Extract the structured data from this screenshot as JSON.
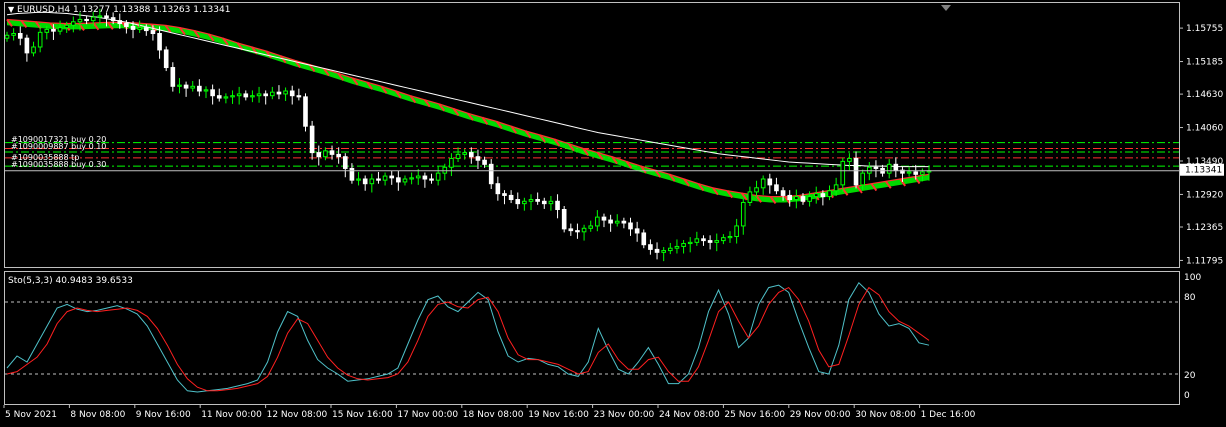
{
  "header": {
    "symbol_line": "EURUSD,H4  1.13277 1.13388 1.13263 1.13341"
  },
  "stochastic": {
    "label": "Sto(5,3,3) 40.9483 39.6533",
    "levels": [
      "100",
      "80",
      "20",
      "0"
    ]
  },
  "orders": {
    "labels": [
      "#1090017321 buy 0.20",
      "#1090009887 buy 0.10",
      "#1090035888 buy 0.30"
    ],
    "label_sub": "#1090035888 tp"
  },
  "colors": {
    "bull": "#00ff00",
    "bear": "#ffffff",
    "ma_long": "#ffffff",
    "band_red": "#ff3030",
    "band_green": "#00ff00",
    "sto_main": "#4fc1c9",
    "sto_signal": "#ff2020",
    "grid": "#808080",
    "bg": "#000000"
  },
  "chart_data": {
    "type": "line",
    "symbol": "EURUSD",
    "timeframe": "H4",
    "price_axis": [
      "1.15755",
      "1.15185",
      "1.14630",
      "1.14060",
      "1.13490",
      "1.12920",
      "1.12365",
      "1.11795"
    ],
    "current_price": "1.13341",
    "ylim": [
      1.117,
      1.162
    ],
    "time_axis": [
      "5 Nov 2021",
      "8 Nov 08:00",
      "9 Nov 16:00",
      "11 Nov 00:00",
      "12 Nov 08:00",
      "15 Nov 16:00",
      "17 Nov 00:00",
      "18 Nov 08:00",
      "19 Nov 16:00",
      "23 Nov 00:00",
      "24 Nov 08:00",
      "25 Nov 16:00",
      "29 Nov 00:00",
      "30 Nov 08:00",
      "1 Dec 16:00"
    ],
    "order_levels": [
      1.1382,
      1.1372,
      1.1366,
      1.1356,
      1.1342
    ],
    "close": [
      1.1565,
      1.1568,
      1.156,
      1.1535,
      1.1545,
      1.157,
      1.1575,
      1.1572,
      1.1578,
      1.1582,
      1.1588,
      1.1592,
      1.159,
      1.1596,
      1.1598,
      1.1595,
      1.159,
      1.1585,
      1.158,
      1.1575,
      1.1578,
      1.1573,
      1.1568,
      1.154,
      1.151,
      1.1478,
      1.148,
      1.1475,
      1.1478,
      1.147,
      1.1472,
      1.1462,
      1.1458,
      1.146,
      1.1462,
      1.1465,
      1.146,
      1.1462,
      1.1465,
      1.1462,
      1.1468,
      1.1465,
      1.147,
      1.1462,
      1.146,
      1.141,
      1.1365,
      1.1358,
      1.1368,
      1.1362,
      1.1358,
      1.1338,
      1.1318,
      1.132,
      1.1312,
      1.132,
      1.1318,
      1.1325,
      1.1322,
      1.1315,
      1.132,
      1.1322,
      1.1325,
      1.132,
      1.1318,
      1.133,
      1.134,
      1.1355,
      1.1362,
      1.1365,
      1.1358,
      1.1352,
      1.1345,
      1.1312,
      1.1295,
      1.1292,
      1.1285,
      1.1278,
      1.1282,
      1.1285,
      1.1282,
      1.1278,
      1.1282,
      1.1268,
      1.1235,
      1.1232,
      1.123,
      1.1236,
      1.124,
      1.1255,
      1.125,
      1.1245,
      1.1248,
      1.1245,
      1.1235,
      1.1228,
      1.1208,
      1.12,
      1.1195,
      1.1198,
      1.1202,
      1.1205,
      1.121,
      1.1212,
      1.1218,
      1.1215,
      1.1212,
      1.1215,
      1.122,
      1.1222,
      1.124,
      1.128,
      1.1298,
      1.1305,
      1.132,
      1.131,
      1.13,
      1.1292,
      1.1285,
      1.129,
      1.1282,
      1.129,
      1.1295,
      1.129,
      1.13,
      1.131,
      1.135,
      1.1355,
      1.131,
      1.133,
      1.134,
      1.1338,
      1.133,
      1.1345,
      1.1335,
      1.133,
      1.1332,
      1.1328,
      1.1332,
      1.1334
    ],
    "ma_long": [
      1.16,
      1.1602,
      1.1603,
      1.1604,
      1.1604,
      1.1603,
      1.1602,
      1.16,
      1.1598,
      1.1596,
      1.1593,
      1.159,
      1.1587,
      1.1583,
      1.1579,
      1.1575,
      1.1571,
      1.1567,
      1.1563,
      1.1559,
      1.1555,
      1.1551,
      1.1547,
      1.1543,
      1.1539,
      1.1535,
      1.1531,
      1.1527,
      1.1523,
      1.1519,
      1.1515,
      1.1511,
      1.1507,
      1.1503,
      1.1499,
      1.1495,
      1.1491,
      1.1487,
      1.1483,
      1.1479,
      1.1475,
      1.1471,
      1.1467,
      1.1463,
      1.1459,
      1.1455,
      1.1451,
      1.1447,
      1.1443,
      1.1439,
      1.1435,
      1.1431,
      1.1427,
      1.1423,
      1.1419,
      1.1415,
      1.1411,
      1.1407,
      1.1403,
      1.1399,
      1.1396,
      1.1393,
      1.139,
      1.1387,
      1.1384,
      1.1381,
      1.1378,
      1.1375,
      1.1372,
      1.1369,
      1.1366,
      1.1363,
      1.1361,
      1.1359,
      1.1357,
      1.1355,
      1.1353,
      1.1351,
      1.1349,
      1.1348,
      1.1347,
      1.1346,
      1.1345,
      1.1344,
      1.1343,
      1.1343,
      1.1342,
      1.1342,
      1.1342,
      1.1341,
      1.1341,
      1.1341,
      1.1341
    ],
    "band_upper": [
      1.1592,
      1.159,
      1.1588,
      1.1586,
      1.1585,
      1.1585,
      1.1586,
      1.1587,
      1.1587,
      1.1586,
      1.1584,
      1.1582,
      1.1578,
      1.1573,
      1.1567,
      1.156,
      1.1552,
      1.1545,
      1.1538,
      1.153,
      1.1522,
      1.1515,
      1.1508,
      1.15,
      1.1492,
      1.1485,
      1.1478,
      1.147,
      1.1462,
      1.1455,
      1.1448,
      1.144,
      1.1432,
      1.1425,
      1.1418,
      1.141,
      1.1402,
      1.1395,
      1.1388,
      1.138,
      1.1372,
      1.1365,
      1.1358,
      1.135,
      1.1342,
      1.1335,
      1.1328,
      1.132,
      1.1312,
      1.1305,
      1.13,
      1.1296,
      1.1292,
      1.129,
      1.129,
      1.1292,
      1.1296,
      1.13,
      1.1304,
      1.1308,
      1.1312,
      1.1316,
      1.132,
      1.1324,
      1.1328
    ],
    "band_lower": [
      1.1582,
      1.158,
      1.1578,
      1.1576,
      1.1575,
      1.1575,
      1.1576,
      1.1577,
      1.1577,
      1.1576,
      1.1574,
      1.1572,
      1.1568,
      1.1563,
      1.1557,
      1.155,
      1.1542,
      1.1535,
      1.1528,
      1.152,
      1.1512,
      1.1505,
      1.1498,
      1.149,
      1.1482,
      1.1475,
      1.1468,
      1.146,
      1.1452,
      1.1445,
      1.1438,
      1.143,
      1.1422,
      1.1415,
      1.1408,
      1.14,
      1.1392,
      1.1385,
      1.1378,
      1.137,
      1.1362,
      1.1355,
      1.1348,
      1.134,
      1.1332,
      1.1325,
      1.1318,
      1.131,
      1.1302,
      1.1295,
      1.129,
      1.1286,
      1.1282,
      1.128,
      1.128,
      1.1282,
      1.1286,
      1.129,
      1.1294,
      1.1298,
      1.1302,
      1.1306,
      1.131,
      1.1314,
      1.1318
    ],
    "sto_main": [
      25,
      35,
      30,
      45,
      60,
      75,
      78,
      74,
      72,
      73,
      75,
      77,
      74,
      70,
      60,
      45,
      30,
      15,
      6,
      5,
      6,
      7,
      8,
      10,
      12,
      15,
      30,
      55,
      72,
      68,
      48,
      32,
      25,
      20,
      14,
      15,
      16,
      18,
      20,
      25,
      45,
      65,
      82,
      85,
      76,
      72,
      80,
      88,
      82,
      55,
      35,
      30,
      33,
      32,
      28,
      26,
      20,
      18,
      30,
      58,
      40,
      24,
      20,
      30,
      42,
      28,
      12,
      12,
      20,
      42,
      72,
      90,
      70,
      42,
      50,
      78,
      92,
      94,
      88,
      64,
      42,
      22,
      20,
      44,
      82,
      96,
      88,
      70,
      60,
      62,
      58,
      46,
      44
    ],
    "sto_signal": [
      20,
      22,
      28,
      34,
      45,
      62,
      72,
      75,
      73,
      72,
      73,
      74,
      75,
      73,
      68,
      58,
      44,
      28,
      16,
      9,
      6,
      6,
      7,
      8,
      10,
      12,
      18,
      34,
      54,
      66,
      62,
      48,
      34,
      25,
      19,
      16,
      15,
      16,
      17,
      20,
      30,
      48,
      68,
      78,
      80,
      76,
      75,
      82,
      84,
      72,
      50,
      36,
      32,
      32,
      30,
      28,
      24,
      20,
      22,
      38,
      45,
      32,
      24,
      24,
      32,
      34,
      22,
      14,
      14,
      26,
      48,
      72,
      80,
      64,
      50,
      60,
      78,
      88,
      92,
      82,
      64,
      40,
      26,
      28,
      52,
      78,
      92,
      86,
      72,
      64,
      60,
      54,
      48
    ]
  }
}
